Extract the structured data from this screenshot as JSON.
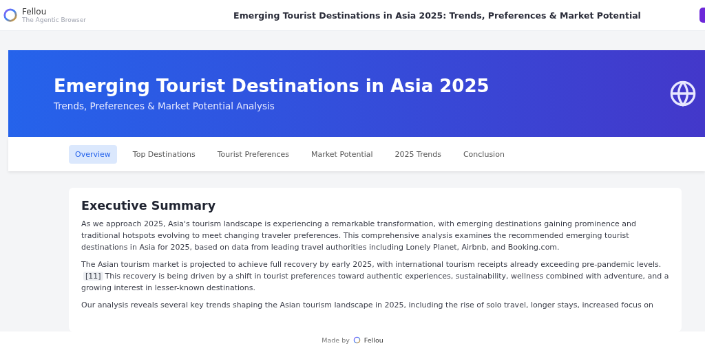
{
  "app": {
    "name": "Fellou",
    "tagline": "The Agentic Browser"
  },
  "page_title": "Emerging Tourist Destinations in Asia 2025: Trends, Preferences & Market Potential",
  "banner": {
    "title": "Emerging Tourist Destinations in Asia 2025",
    "subtitle": "Trends, Preferences & Market Potential Analysis"
  },
  "nav": [
    {
      "label": "Overview",
      "selected": true
    },
    {
      "label": "Top Destinations",
      "selected": false
    },
    {
      "label": "Tourist Preferences",
      "selected": false
    },
    {
      "label": "Market Potential",
      "selected": false
    },
    {
      "label": "2025 Trends",
      "selected": false
    },
    {
      "label": "Conclusion",
      "selected": false
    }
  ],
  "section": {
    "heading": "Executive Summary",
    "paragraphs": [
      {
        "text": "As we approach 2025, Asia's tourism landscape is experiencing a remarkable transformation, with emerging destinations gaining prominence and traditional hotspots evolving to meet changing traveler preferences. This comprehensive analysis examines the recommended emerging tourist destinations in Asia for 2025, based on data from leading travel authorities including Lonely Planet, Airbnb, and Booking.com."
      },
      {
        "text": "The Asian tourism market is projected to achieve full recovery by early 2025, with international tourism receipts already exceeding pre-pandemic levels.",
        "citation": "[11]",
        "after": "This recovery is being driven by a shift in tourist preferences toward authentic experiences, sustainability, wellness combined with adventure, and a growing interest in lesser-known destinations."
      },
      {
        "text": "Our analysis reveals several key trends shaping the Asian tourism landscape in 2025, including the rise of solo travel, longer stays, increased focus on"
      }
    ]
  },
  "footer": {
    "label": "Made by",
    "brand": "Fellou"
  }
}
